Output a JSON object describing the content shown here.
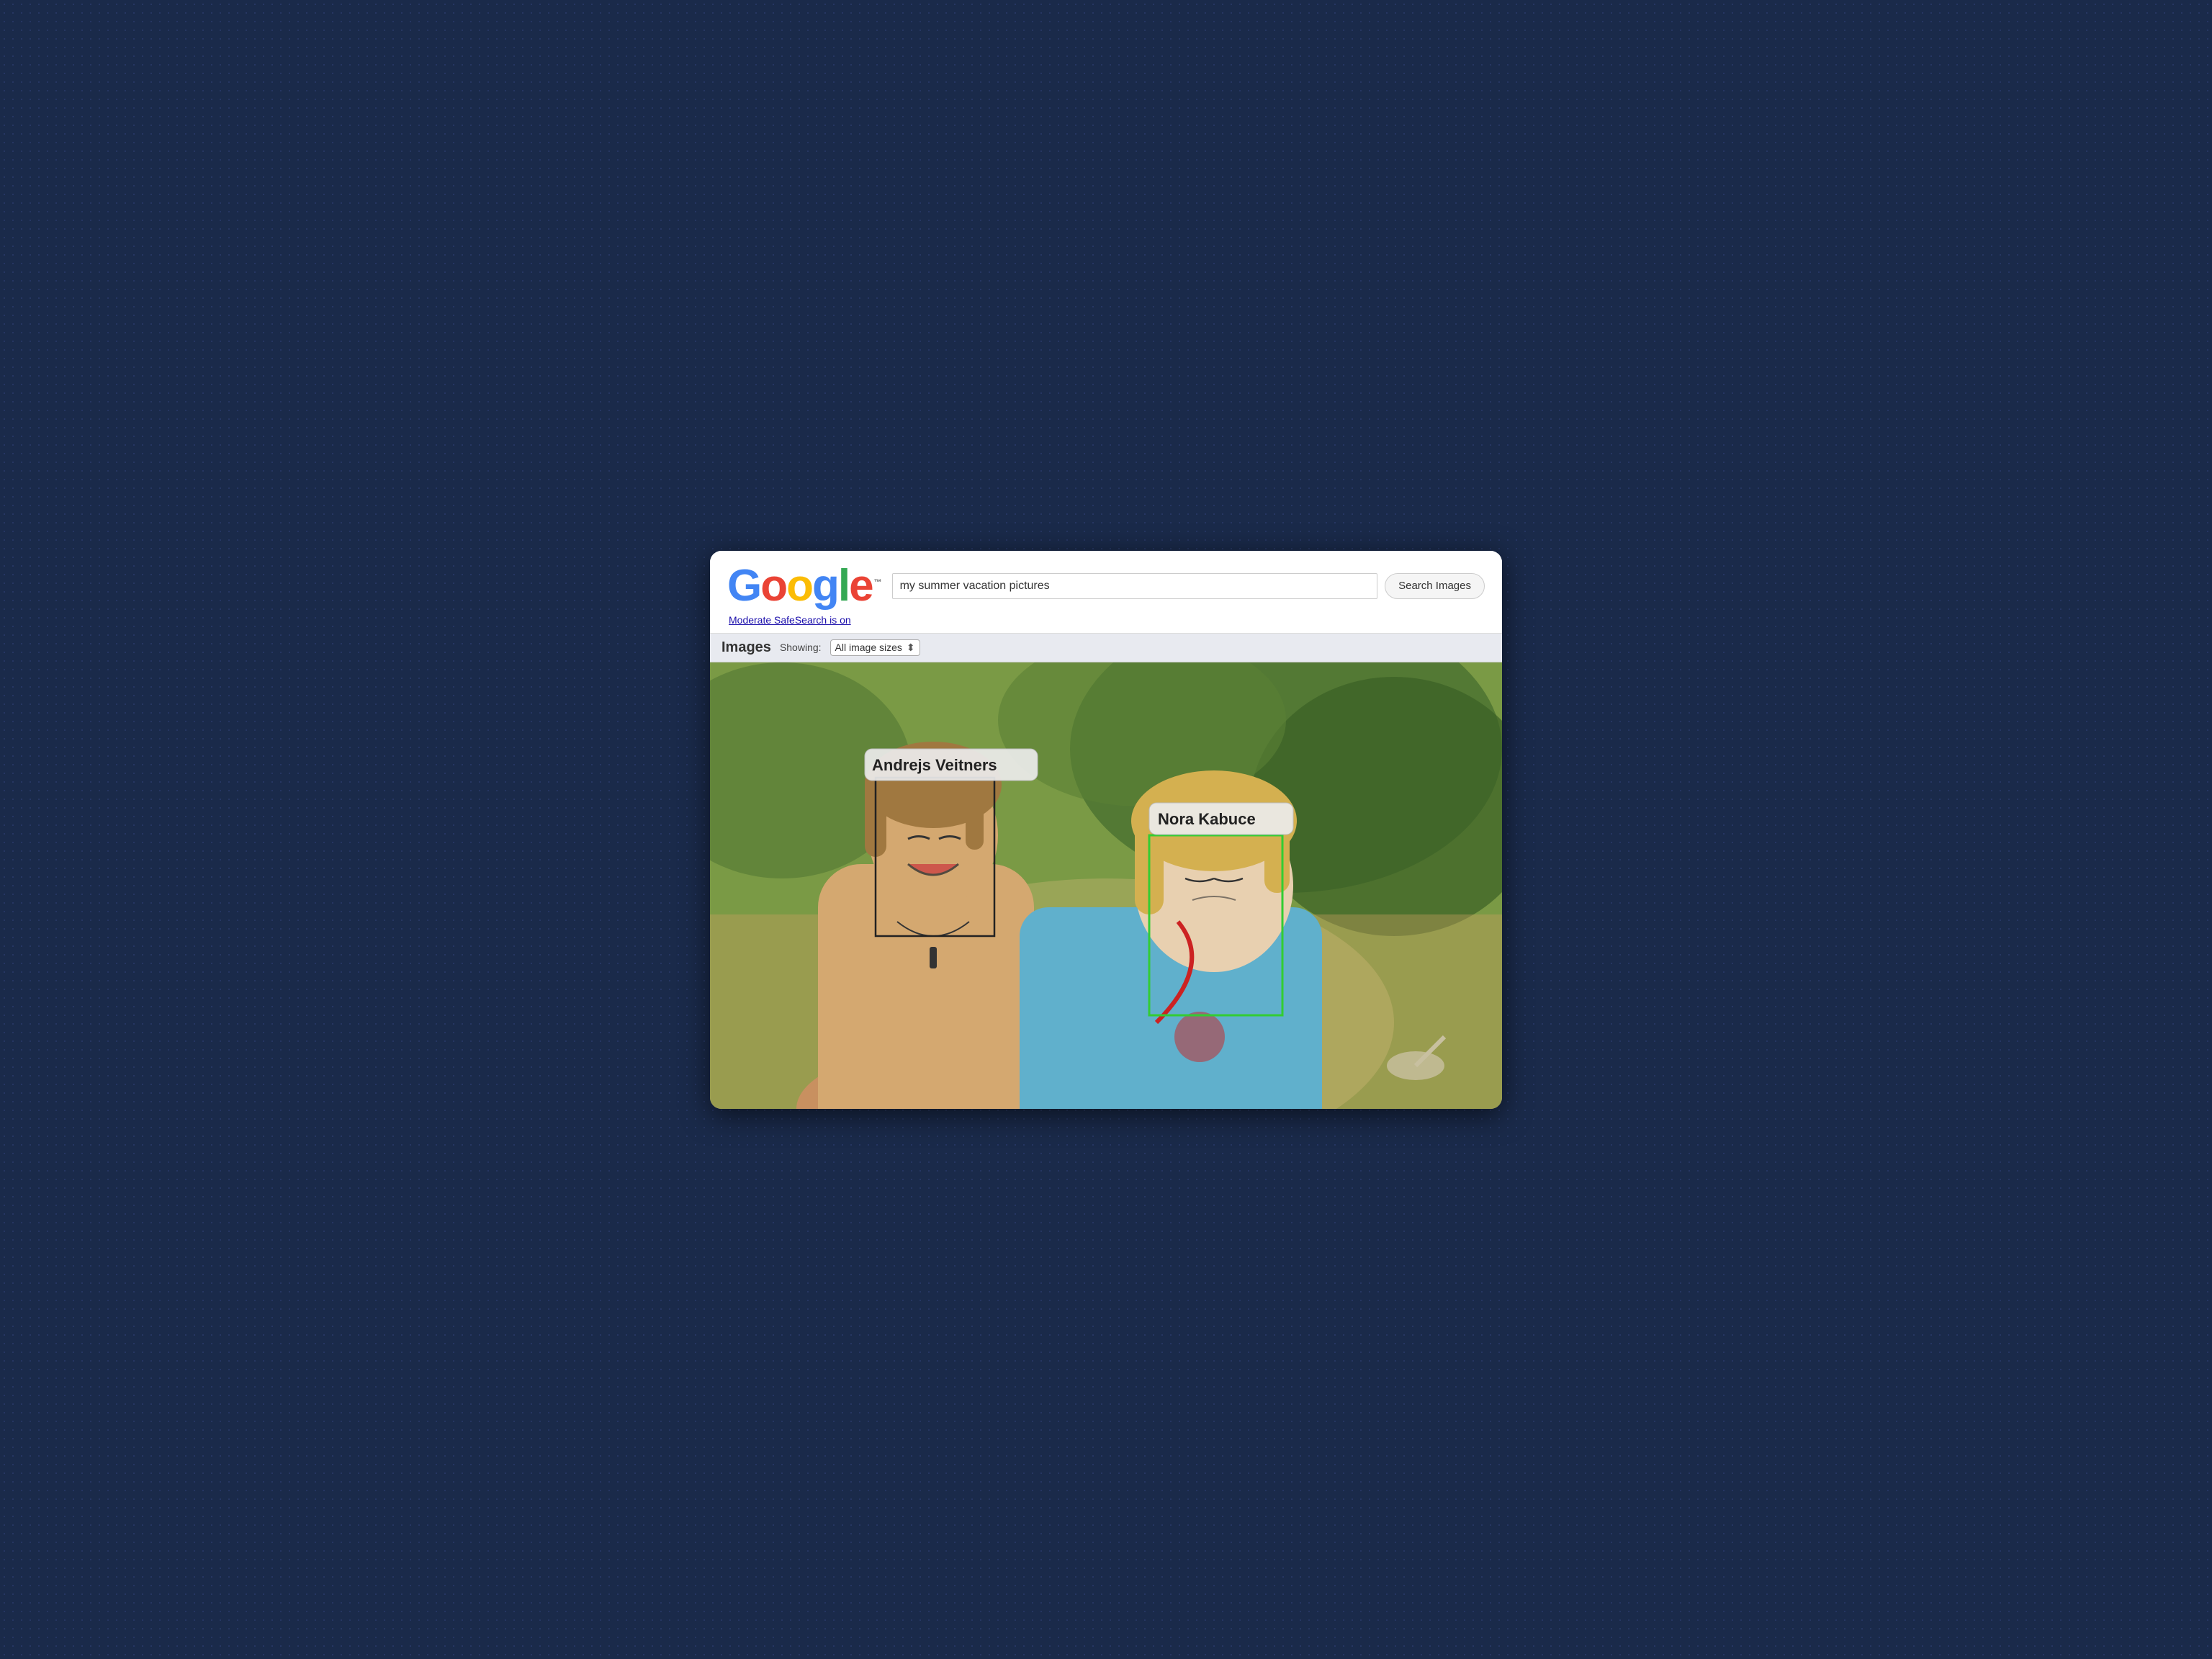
{
  "logo": {
    "letters": [
      {
        "char": "G",
        "class": "logo-g"
      },
      {
        "char": "o",
        "class": "logo-o1"
      },
      {
        "char": "o",
        "class": "logo-o2"
      },
      {
        "char": "g",
        "class": "logo-g2"
      },
      {
        "char": "l",
        "class": "logo-l"
      },
      {
        "char": "e",
        "class": "logo-e"
      }
    ],
    "tm": "™"
  },
  "header": {
    "search_value": "my summer vacation pictures",
    "search_placeholder": "Search",
    "search_button_label": "Search Images",
    "safesearch_label": "Moderate SafeSearch is on"
  },
  "images_bar": {
    "label": "Images",
    "showing_label": "Showing:",
    "size_filter": "All image sizes",
    "size_arrow": "⬍"
  },
  "face_tags": {
    "person1": {
      "name": "Andrejs Veitners"
    },
    "person2": {
      "name": "Nora Kabuce"
    }
  }
}
